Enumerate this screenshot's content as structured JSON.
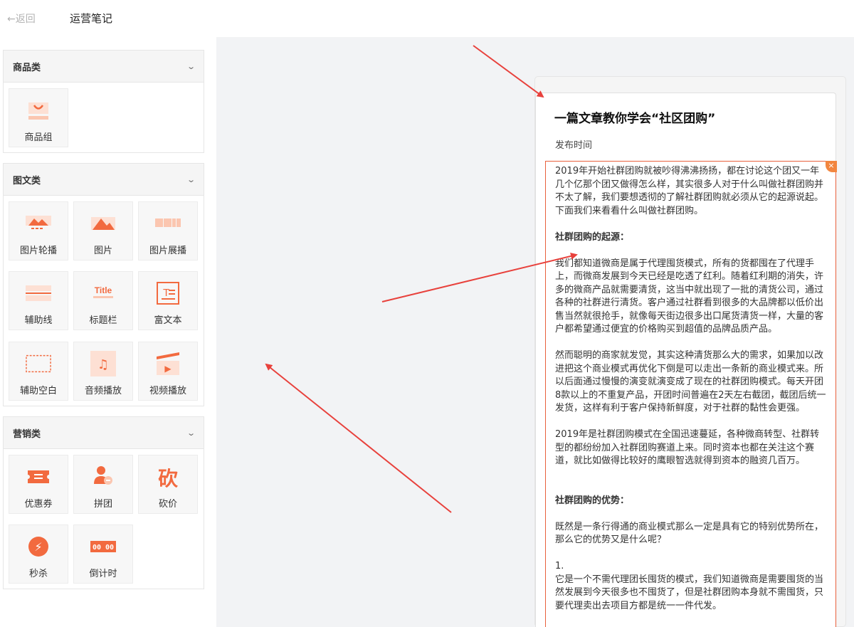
{
  "header": {
    "back_label": "←返回",
    "title": "运营笔记"
  },
  "sidebar": {
    "sections": [
      {
        "title": "商品类",
        "items": [
          {
            "label": "商品组",
            "icon": "shopping-bag-icon"
          }
        ]
      },
      {
        "title": "图文类",
        "items": [
          {
            "label": "图片轮播",
            "icon": "image-carousel-icon"
          },
          {
            "label": "图片",
            "icon": "image-icon"
          },
          {
            "label": "图片展播",
            "icon": "image-gallery-icon"
          },
          {
            "label": "辅助线",
            "icon": "divider-line-icon"
          },
          {
            "label": "标题栏",
            "icon": "title-bar-icon",
            "glyph": "Title"
          },
          {
            "label": "富文本",
            "icon": "rich-text-icon",
            "glyph": "T"
          },
          {
            "label": "辅助空白",
            "icon": "blank-space-icon"
          },
          {
            "label": "音频播放",
            "icon": "music-note-icon",
            "glyph": "♫"
          },
          {
            "label": "视频播放",
            "icon": "video-play-icon",
            "glyph": "▶"
          }
        ]
      },
      {
        "title": "营销类",
        "items": [
          {
            "label": "优惠券",
            "icon": "coupon-icon"
          },
          {
            "label": "拼团",
            "icon": "group-buy-icon"
          },
          {
            "label": "砍价",
            "icon": "bargain-icon",
            "glyph": "砍"
          },
          {
            "label": "秒杀",
            "icon": "lightning-icon",
            "glyph": "⚡"
          },
          {
            "label": "倒计时",
            "icon": "countdown-icon",
            "glyph": "00 00"
          }
        ]
      }
    ]
  },
  "preview": {
    "title": "一篇文章教你学会“社区团购”",
    "publish_label": "发布时间",
    "close_glyph": "×",
    "paragraphs": [
      {
        "type": "p",
        "text": "2019年开始社群团购就被吵得沸沸扬扬，都在讨论这个团又一年几个亿那个团又做得怎么样，其实很多人对于什么叫做社群团购并不太了解，我们要想透彻的了解社群团购就必须从它的起源说起。下面我们来看看什么叫做社群团购。"
      },
      {
        "type": "gap"
      },
      {
        "type": "h",
        "text": "社群团购的起源："
      },
      {
        "type": "gap"
      },
      {
        "type": "p",
        "text": "我们都知道微商是属于代理囤货模式，所有的货都囤在了代理手上，而微商发展到今天已经是吃透了红利。随着红利期的消失，许多的微商产品就需要清货，这当中就出现了一批的清货公司，通过各种的社群进行清货。客户通过社群看到很多的大品牌都以低价出售当然就很抢手，就像每天街边很多出口尾货清货一样，大量的客户都希望通过便宜的价格购买到超值的品牌品质产品。"
      },
      {
        "type": "gap"
      },
      {
        "type": "p",
        "text": "然而聪明的商家就发觉，其实这种清货那么大的需求，如果加以改进把这个商业模式再优化下倒是可以走出一条新的商业模式来。所以后面通过慢慢的演变就演变成了现在的社群团购模式。每天开团8款以上的不重复产品，开团时间普遍在2天左右截团，截团后统一发货，这样有利于客户保持新鲜度，对于社群的黏性会更强。"
      },
      {
        "type": "gap"
      },
      {
        "type": "p",
        "text": "2019年是社群团购模式在全国迅速蔓延，各种微商转型、社群转型的都纷纷加入社群团购赛道上来。同时资本也都在关注这个赛道，就比如做得比较好的鹰眼智选就得到资本的融资几百万。"
      },
      {
        "type": "gap"
      },
      {
        "type": "gap"
      },
      {
        "type": "h",
        "text": "社群团购的优势："
      },
      {
        "type": "gap"
      },
      {
        "type": "p",
        "text": "既然是一条行得通的商业模式那么一定是具有它的特别优势所在，那么它的优势又是什么呢？"
      },
      {
        "type": "gap"
      },
      {
        "type": "p",
        "text": "1."
      },
      {
        "type": "p",
        "text": "它是一个不需代理团长囤货的模式，我们知道微商是需要囤货的当然发展到今天很多也不囤货了，但是社群团购本身就不需囤货，只要代理卖出去项目方都是统一一件代发。"
      }
    ]
  },
  "colors": {
    "accent": "#e8603c",
    "arrow": "#e8413c",
    "icon_orange": "#f26a3f",
    "icon_light": "#fbc6b0"
  }
}
